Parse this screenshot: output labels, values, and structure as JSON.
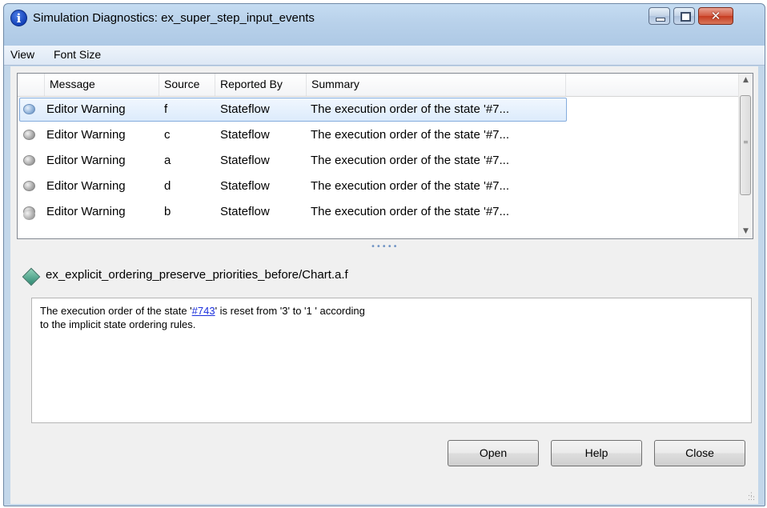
{
  "window": {
    "title": "Simulation Diagnostics: ex_super_step_input_events",
    "title_icon": "info-icon"
  },
  "menu": [
    "View",
    "Font Size"
  ],
  "table": {
    "columns": [
      "Message",
      "Source",
      "Reported By",
      "Summary"
    ],
    "rows": [
      {
        "message": "Editor Warning",
        "source": "f",
        "reported_by": "Stateflow",
        "summary": "The execution order of the state '#7...",
        "selected": true
      },
      {
        "message": "Editor Warning",
        "source": "c",
        "reported_by": "Stateflow",
        "summary": "The execution order of the state '#7..."
      },
      {
        "message": "Editor Warning",
        "source": "a",
        "reported_by": "Stateflow",
        "summary": "The execution order of the state '#7..."
      },
      {
        "message": "Editor Warning",
        "source": "d",
        "reported_by": "Stateflow",
        "summary": "The execution order of the state '#7..."
      },
      {
        "message": "Editor Warning",
        "source": "b",
        "reported_by": "Stateflow",
        "summary": "The execution order of the state '#7..."
      }
    ]
  },
  "detail": {
    "path": "ex_explicit_ordering_preserve_priorities_before/Chart.a.f",
    "message_before": "The execution order of the state '",
    "message_link": "#743",
    "message_after": "' is reset from '3' to '1 ' according",
    "message_line2": "to the implicit state ordering rules."
  },
  "buttons": {
    "open": "Open",
    "help": "Help",
    "close": "Close"
  },
  "colors": {
    "selection_border": "#84acdd",
    "link": "#1a2fdc",
    "close_button": "#c53b20"
  }
}
